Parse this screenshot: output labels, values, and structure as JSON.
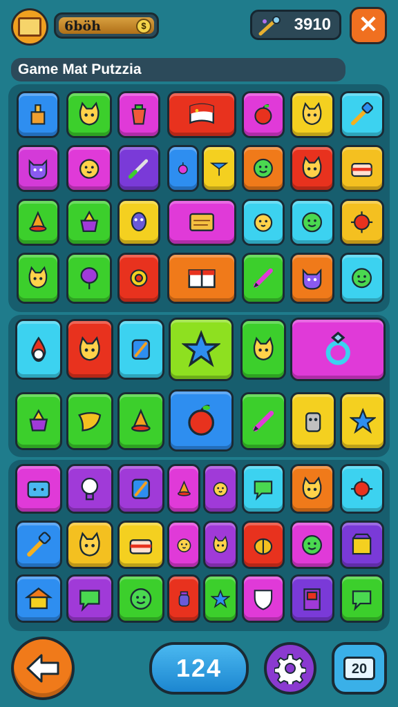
{
  "header": {
    "coin_label": "6böh",
    "coin_icon_glyph": "$",
    "score": "3910",
    "close_glyph": "✕"
  },
  "title": "Game Mat Putzzia",
  "footer": {
    "moves": "124",
    "level": "20"
  },
  "tiles": [
    {
      "color": "#2e8ef0",
      "icon": "tower"
    },
    {
      "color": "#3ccf2c",
      "icon": "cat"
    },
    {
      "color": "#e03ad8",
      "icon": "cup"
    },
    {
      "color": "#e8321e",
      "icon": "flag"
    },
    {
      "color": "#e03ad8",
      "icon": "apple"
    },
    {
      "color": "#f4d020",
      "icon": "cat"
    },
    {
      "color": "#3cd2f0",
      "icon": "brush"
    },
    {
      "color": "#d43ad8",
      "icon": "devil"
    },
    {
      "color": "#e03ad8",
      "icon": "chick"
    },
    {
      "color": "#7a3ad8",
      "icon": "sword"
    },
    {
      "color": "#2e8ef0",
      "icon": "berry"
    },
    {
      "color": "#f4d020",
      "icon": "pin"
    },
    {
      "color": "#f07a1a",
      "icon": "face"
    },
    {
      "color": "#e8321e",
      "icon": "cat"
    },
    {
      "color": "#f4c020",
      "icon": "cake"
    },
    {
      "color": "#3ccf2c",
      "icon": "cone"
    },
    {
      "color": "#3ccf2c",
      "icon": "pot"
    },
    {
      "color": "#f4d020",
      "icon": "mask"
    },
    {
      "color": "#e03ad8",
      "icon": "sign"
    },
    {
      "color": "#3cd2f0",
      "icon": "chick"
    },
    {
      "color": "#3cd2f0",
      "icon": "face"
    },
    {
      "color": "#f4c020",
      "icon": "virus"
    },
    {
      "color": "#3ccf2c",
      "icon": "cat"
    },
    {
      "color": "#3ccf2c",
      "icon": "balloon"
    },
    {
      "color": "#e8321e",
      "icon": "gear"
    },
    {
      "color": "#f07a1a",
      "icon": "book"
    },
    {
      "color": "#3ccf2c",
      "icon": "pencil"
    },
    {
      "color": "#f07a1a",
      "icon": "devil"
    },
    {
      "color": "#3cd2f0",
      "icon": "face"
    },
    {
      "color": "#3cd2f0",
      "icon": "drop"
    },
    {
      "color": "#e8321e",
      "icon": "cat"
    },
    {
      "color": "#3cd2f0",
      "icon": "tool"
    },
    {
      "color": "#8ee020",
      "icon": "star"
    },
    {
      "color": "#3ccf2c",
      "icon": "cat"
    },
    {
      "color": "#e03ad8",
      "icon": "ring"
    },
    {
      "color": "#3ccf2c",
      "icon": "pot"
    },
    {
      "color": "#3ccf2c",
      "icon": "leaf"
    },
    {
      "color": "#3ccf2c",
      "icon": "cone"
    },
    {
      "color": "#2e8ef0",
      "icon": "apple"
    },
    {
      "color": "#3ccf2c",
      "icon": "pencil"
    },
    {
      "color": "#f4d020",
      "icon": "robot"
    },
    {
      "color": "#f4d020",
      "icon": "star"
    },
    {
      "color": "#e03ad8",
      "icon": "tv"
    },
    {
      "color": "#a03ad8",
      "icon": "bulb"
    },
    {
      "color": "#a03ad8",
      "icon": "tool"
    },
    {
      "color": "#e03ad8",
      "icon": "cone"
    },
    {
      "color": "#a03ad8",
      "icon": "chick"
    },
    {
      "color": "#3cd2f0",
      "icon": "chat"
    },
    {
      "color": "#f07a1a",
      "icon": "cat"
    },
    {
      "color": "#3cd2f0",
      "icon": "virus"
    },
    {
      "color": "#2e8ef0",
      "icon": "brush"
    },
    {
      "color": "#f4c020",
      "icon": "cat"
    },
    {
      "color": "#f4d020",
      "icon": "cake"
    },
    {
      "color": "#e03ad8",
      "icon": "chick"
    },
    {
      "color": "#a03ad8",
      "icon": "cat"
    },
    {
      "color": "#e8321e",
      "icon": "pumpkin"
    },
    {
      "color": "#e03ad8",
      "icon": "face"
    },
    {
      "color": "#7a3ad8",
      "icon": "box"
    },
    {
      "color": "#2e8ef0",
      "icon": "house"
    },
    {
      "color": "#a03ad8",
      "icon": "chat"
    },
    {
      "color": "#3ccf2c",
      "icon": "face"
    },
    {
      "color": "#e8321e",
      "icon": "jar"
    },
    {
      "color": "#3ccf2c",
      "icon": "star"
    },
    {
      "color": "#e03ad8",
      "icon": "shield"
    },
    {
      "color": "#7a3ad8",
      "icon": "door"
    },
    {
      "color": "#3ccf2c",
      "icon": "chat"
    }
  ]
}
